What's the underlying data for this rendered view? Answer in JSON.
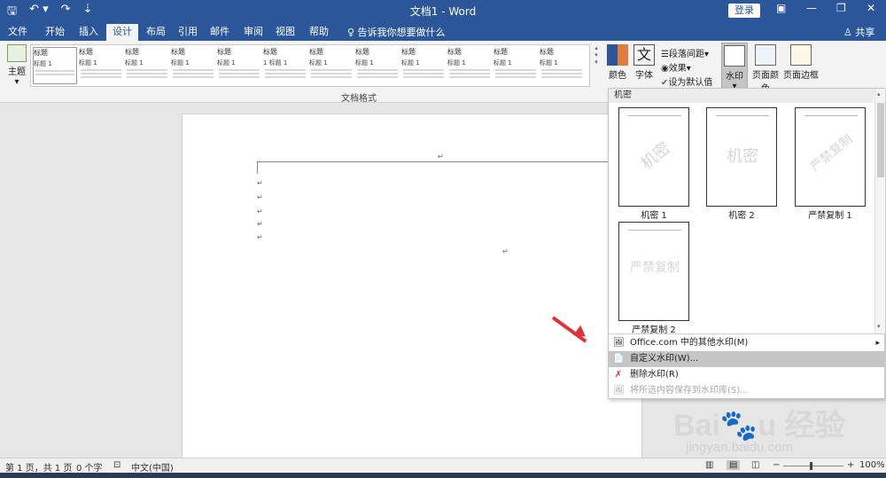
{
  "titlebar": {
    "title": "文档1 - Word",
    "login": "登录",
    "qat": {
      "save": "🖫",
      "undo": "↶ ▾",
      "redo": "↷",
      "more": "⇣"
    },
    "window_buttons": {
      "ribbon_display": "▣",
      "minimize": "—",
      "maximize": "❐",
      "close": "✕"
    }
  },
  "tabs": [
    "文件",
    "开始",
    "插入",
    "设计",
    "布局",
    "引用",
    "邮件",
    "审阅",
    "视图",
    "帮助"
  ],
  "active_tab": "设计",
  "tell_me": "♀ 告诉我你想要做什么",
  "share": "♙ 共享",
  "ribbon": {
    "theme_label": "主题",
    "theme_arrow": "▾",
    "gallery_group_label": "文档格式",
    "style_thumbs": [
      {
        "heading": "标题",
        "sub": "标题 1"
      },
      {
        "heading": "标题",
        "sub": "标题 1"
      },
      {
        "heading": "标题",
        "sub": "标题 1"
      },
      {
        "heading": "标题",
        "sub": "标题 1"
      },
      {
        "heading": "标题",
        "sub": "标题 1"
      },
      {
        "heading": "标题",
        "sub": "1 标题 1"
      },
      {
        "heading": "标题",
        "sub": "标题 1"
      },
      {
        "heading": "标题",
        "sub": "标题 1"
      },
      {
        "heading": "标题",
        "sub": "标题 1"
      },
      {
        "heading": "标题",
        "sub": "标题 1"
      },
      {
        "heading": "标题",
        "sub": "标题 1"
      },
      {
        "heading": "标题",
        "sub": "标题 1"
      }
    ],
    "colors_label": "颜色",
    "fonts_label": "字体",
    "paragraph_spacing": "段落间距",
    "effects": "效果",
    "set_default": "设为默认值",
    "watermark_label": "水印",
    "page_color_label": "页面颜色",
    "page_border_label": "页面边框",
    "dropdown_arrow": "▾"
  },
  "watermark_menu": {
    "section_title": "机密",
    "cards": [
      {
        "text": "机密",
        "label": "机密 1"
      },
      {
        "text": "机密",
        "label": "机密 2"
      },
      {
        "text": "严禁复制",
        "label": "严禁复制 1"
      },
      {
        "text": "严禁复制",
        "label": "严禁复制 2"
      }
    ],
    "items": [
      {
        "label": "Office.com 中的其他水印(M)",
        "icon": "🖼"
      },
      {
        "label": "自定义水印(W)...",
        "icon": "📄"
      },
      {
        "label": "删除水印(R)",
        "icon": "✗"
      },
      {
        "label": "将所选内容保存到水印库(S)...",
        "icon": "🖼"
      }
    ],
    "submenu_chevron": "▸",
    "scroll_up": "▴",
    "scroll_down": "▾"
  },
  "document": {
    "paragraph_mark": "↵"
  },
  "statusbar": {
    "page": "第 1 页，共 1 页",
    "words": "0 个字",
    "proof_icon": "⊡",
    "language": "中文(中国)",
    "zoom_minus": "−",
    "zoom_plus": "+",
    "zoom": "100%"
  },
  "overlay": {
    "logo": "Bai🐾u 经验",
    "url": "jingyan.baidu.com"
  },
  "colors": {
    "word_blue": "#2b579a",
    "arrow_red": "#e0323a"
  }
}
